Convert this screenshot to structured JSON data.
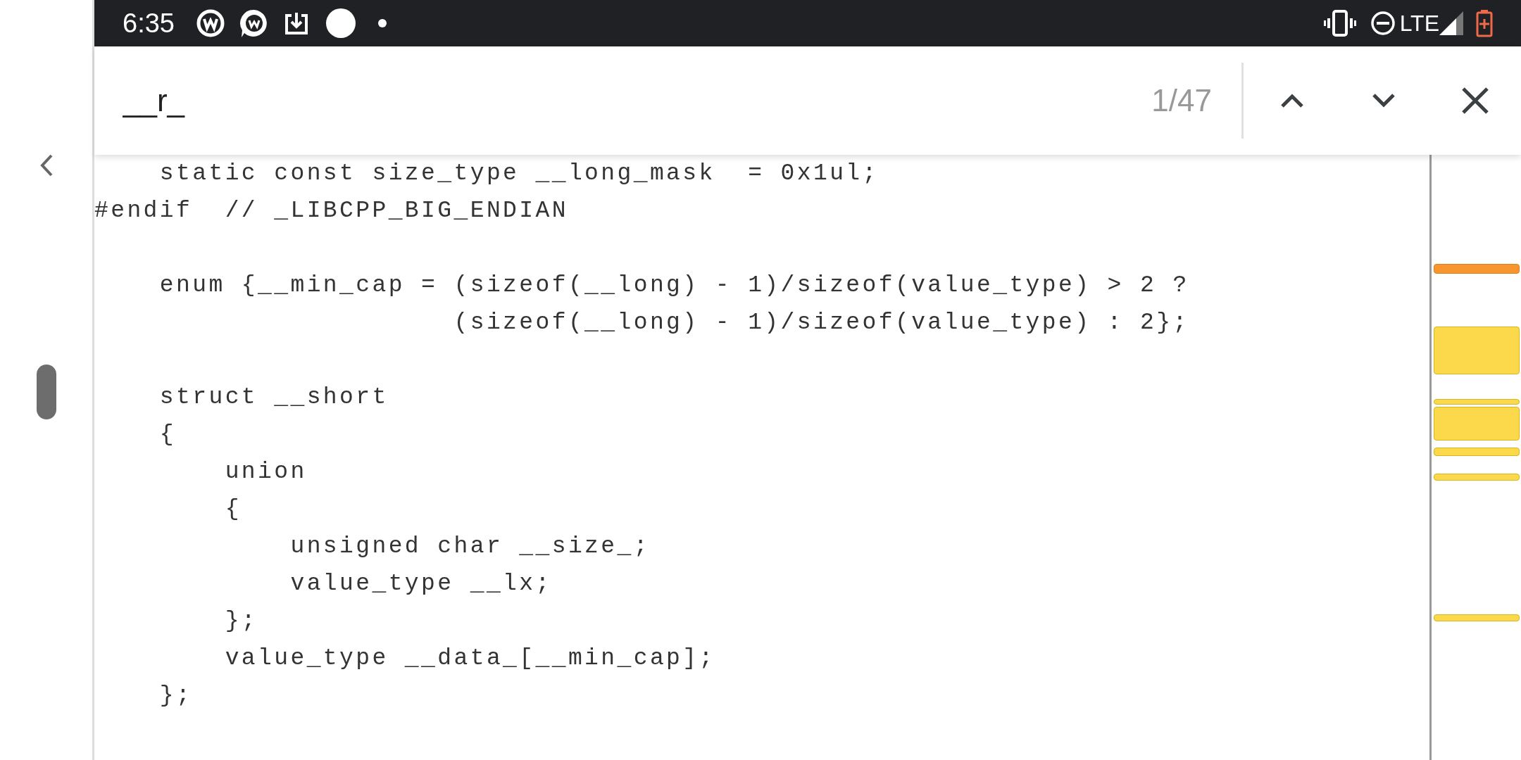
{
  "status_bar": {
    "time": "6:35",
    "network": "LTE"
  },
  "find_bar": {
    "query": "__r_",
    "match_count": "1/47"
  },
  "code_blocks": [
    [
      "    static const size_type __long_mask  = 0x1ul;",
      "#endif  // _LIBCPP_BIG_ENDIAN"
    ],
    [
      "    enum {__min_cap = (sizeof(__long) - 1)/sizeof(value_type) > 2 ?",
      "                      (sizeof(__long) - 1)/sizeof(value_type) : 2};"
    ],
    [
      "    struct __short",
      "    {",
      "        union",
      "        {",
      "            unsigned char __size_;",
      "            value_type __lx;",
      "        };",
      "        value_type __data_[__min_cap];",
      "    };"
    ]
  ]
}
